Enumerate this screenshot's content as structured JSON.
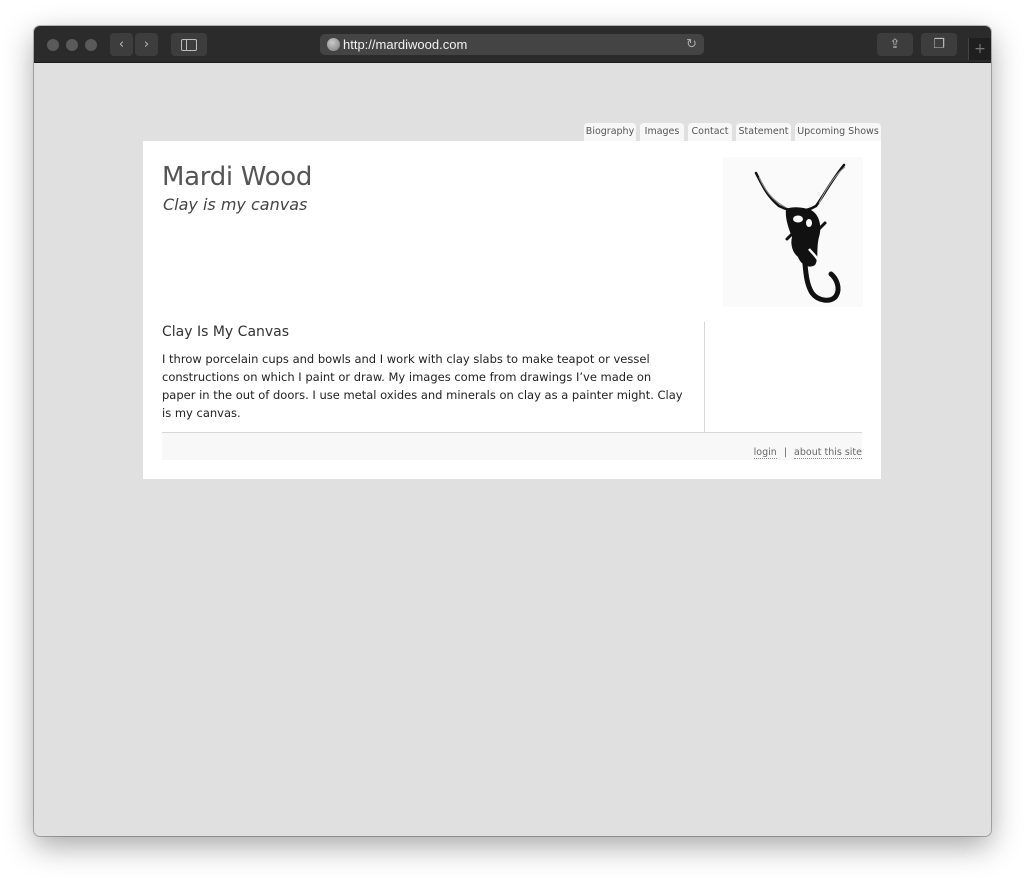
{
  "browser": {
    "url": "http://mardiwood.com",
    "back_label": "‹",
    "forward_label": "›",
    "reload_label": "↻",
    "share_label": "⇪",
    "tabs_label": "❐",
    "new_tab_label": "+"
  },
  "nav": {
    "tabs": [
      {
        "label": "Biography"
      },
      {
        "label": "Images"
      },
      {
        "label": "Contact"
      },
      {
        "label": "Statement"
      },
      {
        "label": "Upcoming Shows"
      }
    ]
  },
  "header": {
    "site_name": "Mardi Wood",
    "slogan": "Clay is my canvas",
    "logo_icon": "ink-figure-drawing"
  },
  "content": {
    "title": "Clay Is My Canvas",
    "body": "I throw porcelain cups and bowls and I work with clay slabs to make teapot or vessel constructions on which I paint or draw. My images come from drawings I’ve made on paper in the out of doors. I use metal oxides and minerals on clay as a painter might. Clay is my canvas."
  },
  "footer": {
    "login": "login",
    "separator": "|",
    "about": "about this site"
  },
  "colors": {
    "toolbar": "#2b2b2b",
    "page_background": "#e0e0e0",
    "content_background": "#ffffff",
    "tab_background": "#f7f7f7",
    "title_text": "#555555"
  }
}
